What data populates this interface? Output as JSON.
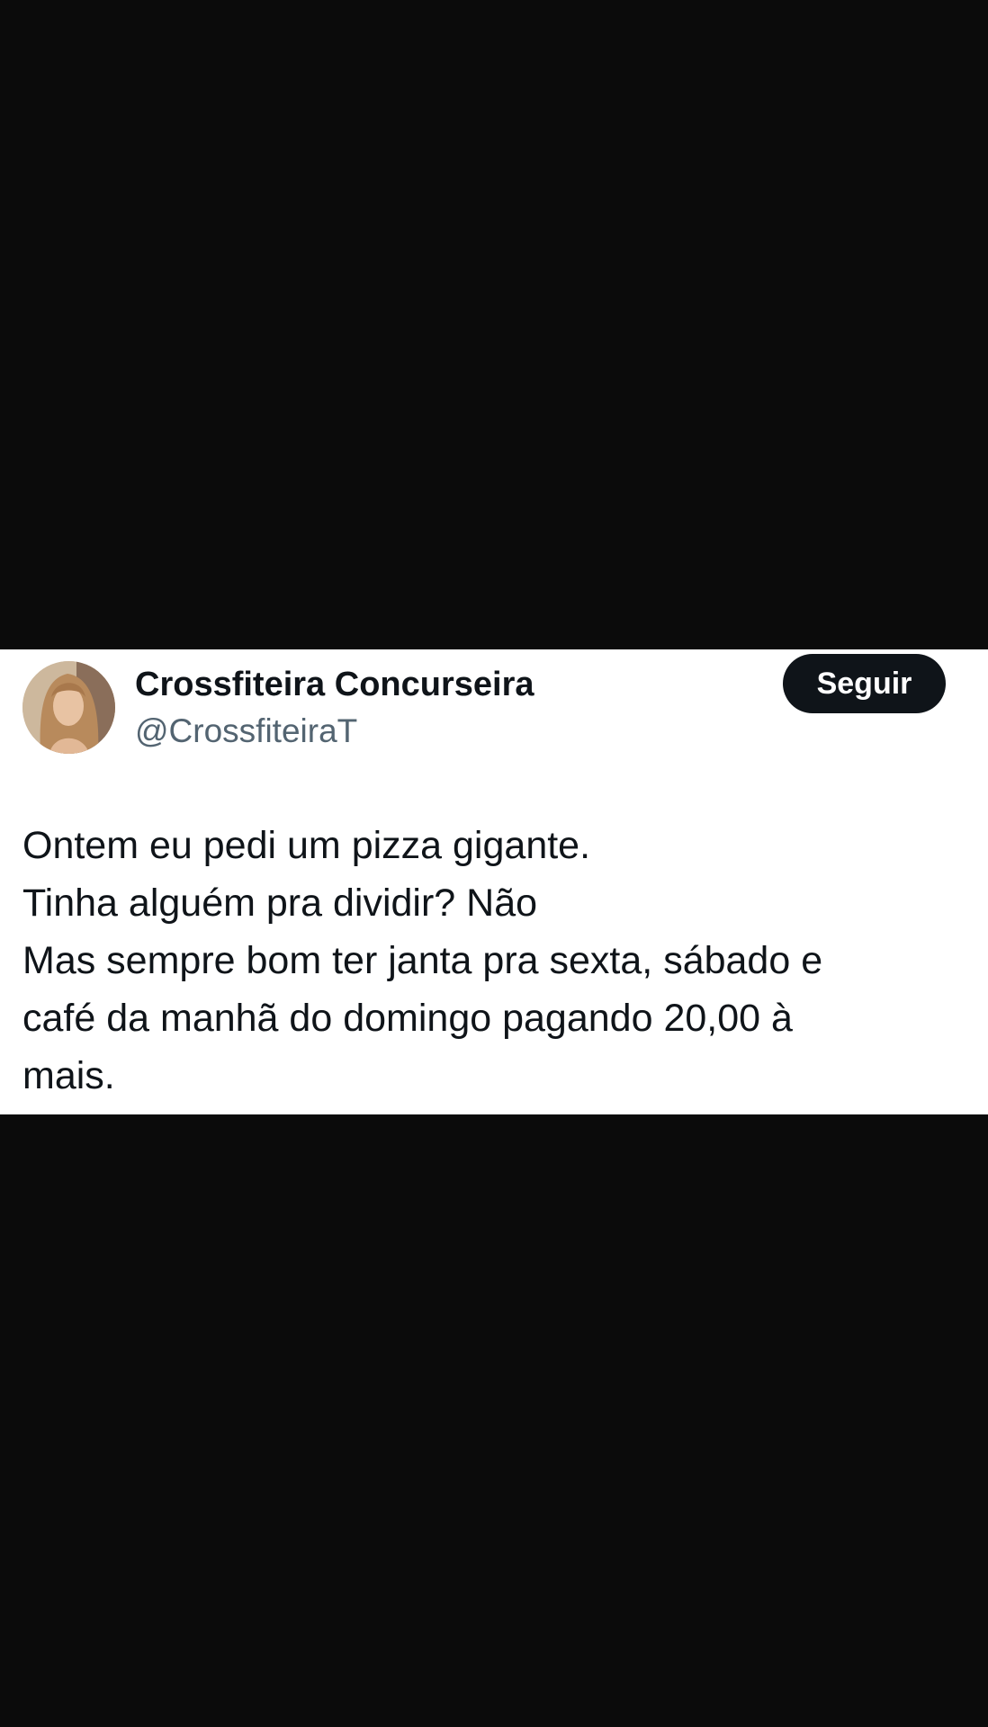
{
  "tweet": {
    "author": {
      "display_name": "Crossfiteira Concurseira",
      "handle": "@CrossfiteiraT",
      "avatar": "profile-photo"
    },
    "follow_label": "Seguir",
    "text_lines": [
      "Ontem eu pedi um pizza gigante.",
      "Tinha alguém pra dividir? Não",
      "Mas sempre bom ter janta pra sexta, sábado e",
      "café da manhã do domingo pagando 20,00 à",
      "mais."
    ]
  },
  "colors": {
    "background": "#0b0b0b",
    "card": "#ffffff",
    "text_primary": "#0f1419",
    "text_secondary": "#536471",
    "button": "#0f1419"
  }
}
